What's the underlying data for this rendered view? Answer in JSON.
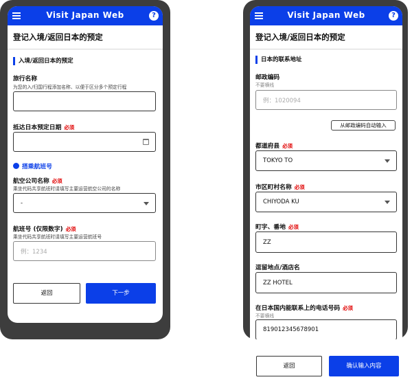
{
  "app": {
    "title": "Visit Japan Web",
    "help": "?"
  },
  "colors": {
    "brand": "#0b3fe8",
    "required": "#e00000",
    "frame": "#3d3d3d"
  },
  "left": {
    "page_title": "登记入境/返回日本的预定",
    "section": "入境/返回日本的预定",
    "trip_name": {
      "label": "旅行名称",
      "hint": "为您的入/归国行程添加名称、以便于区分多个预定行程",
      "value": ""
    },
    "arrival_date": {
      "label": "抵达日本预定日期",
      "required": "必须",
      "value": ""
    },
    "transport": {
      "label": "搭乘航班号"
    },
    "airline": {
      "label": "航空公司名称",
      "required": "必须",
      "hint": "乘坐代码共享航班时请填写主要运营航空公司的名称",
      "value": "-"
    },
    "flight_no": {
      "label": "航班号 (仅限数字)",
      "required": "必须",
      "hint": "乘坐代码共享航班时请填写主要运营航班号",
      "placeholder": "例：1234"
    },
    "back_button": "返回",
    "next_button": "下一步"
  },
  "right": {
    "page_title": "登记入境/返回日本的预定",
    "section": "日本的联系地址",
    "postal": {
      "label": "邮政编码",
      "hint": "不要横线",
      "placeholder": "例：1020094",
      "auto_button": "从邮政编码自动输入"
    },
    "prefecture": {
      "label": "都道府县",
      "required": "必须",
      "value": "TOKYO TO"
    },
    "city": {
      "label": "市区町村名称",
      "required": "必须",
      "value": "CHIYODA KU"
    },
    "street": {
      "label": "町字、番地",
      "required": "必须",
      "value": "ZZ"
    },
    "hotel": {
      "label": "逗留地点/酒店名",
      "value": "ZZ HOTEL"
    },
    "phone": {
      "label": "在日本国内能联系上的电话号码",
      "required": "必须",
      "hint": "不要横线",
      "value": "819012345678901"
    },
    "back_button": "返回",
    "confirm_button": "确认输入内容"
  }
}
